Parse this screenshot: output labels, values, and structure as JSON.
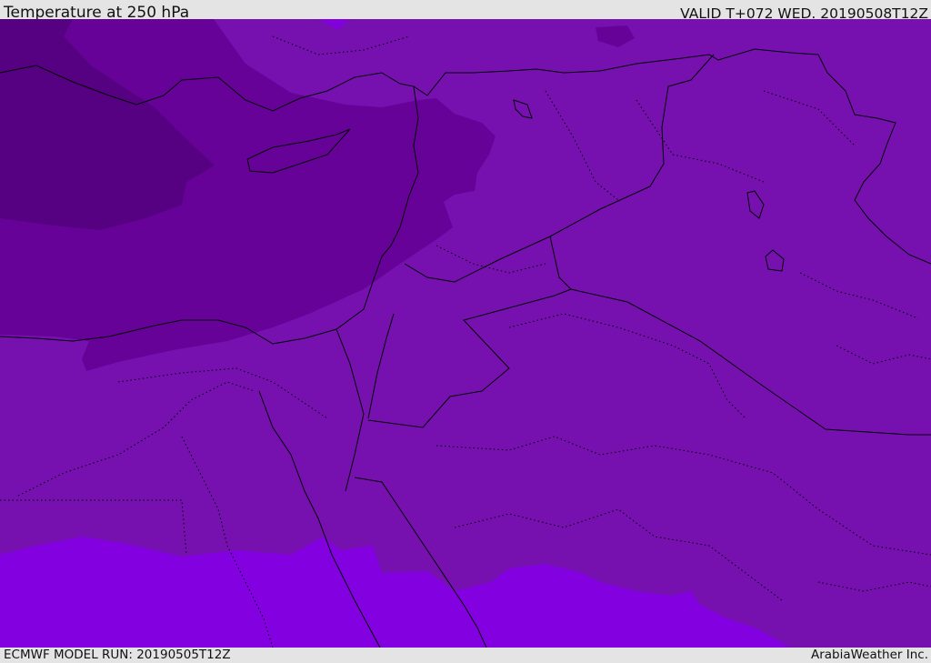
{
  "header": {
    "title": "Temperature at 250 hPa",
    "valid": "VALID T+072 WED. 20190508T12Z"
  },
  "footer": {
    "model_run": "ECMWF MODEL RUN: 20190505T12Z",
    "credit": "ArabiaWeather Inc."
  },
  "map": {
    "colors": {
      "coldest": "#560181",
      "cold": "#670299",
      "base": "#7611b0",
      "warm": "#8300e0",
      "border": "#000000"
    }
  }
}
